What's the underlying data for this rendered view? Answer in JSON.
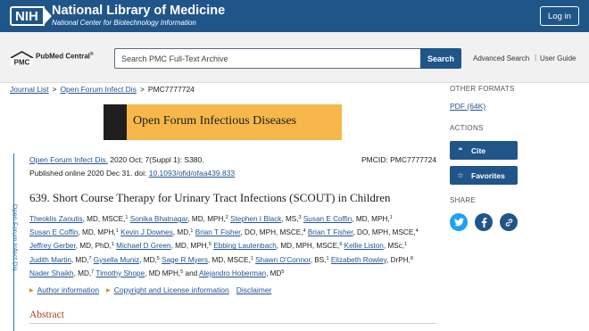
{
  "header": {
    "logo_text": "NIH",
    "title": "National Library of Medicine",
    "subtitle": "National Center for Biotechnology Information",
    "login_label": "Log in"
  },
  "pmc": {
    "logo_label": "PMC",
    "logo_text": "PubMed Central",
    "logo_reg": "®",
    "search_placeholder": "Search PMC Full-Text Archive",
    "search_button": "Search",
    "advanced_search": "Advanced Search",
    "divider": "|",
    "user_guide": "User Guide"
  },
  "breadcrumb": {
    "items": [
      "Journal List",
      "Open Forum Infect Dis",
      "PMC7777724"
    ],
    "separator": ">"
  },
  "journal_banner": "Open Forum Infectious Diseases",
  "side_vertical_label": "Open Forum Infect Dis",
  "citation": {
    "journal": "Open Forum Infect Dis.",
    "details": " 2020 Oct; 7(Suppl 1): S380.",
    "pmcid": "PMCID: PMC7777724",
    "published_prefix": "Published online 2020 Dec 31. doi: ",
    "doi": "10.1093/ofid/ofaa439.833"
  },
  "article_title": "639. Short Course Therapy for Urinary Tract Infections (SCOUT) in Children",
  "authors": [
    {
      "name": "Theoklis Zaoutis",
      "rest": ", MD, MSCE,",
      "sup": "1"
    },
    {
      "name": "Sonika Bhatnagar",
      "rest": ", MD, MPH,",
      "sup": "2"
    },
    {
      "name": "Stephen I Black",
      "rest": ", MS,",
      "sup": "3"
    },
    {
      "name": "Susan E Coffin",
      "rest": ", MD, MPH,",
      "sup": "1"
    },
    {
      "name": "Susan E Coffin",
      "rest": ", MD, MPH,",
      "sup": "1"
    },
    {
      "name": "Kevin J Downes",
      "rest": ", MD,",
      "sup": "1"
    },
    {
      "name": "Brian T Fisher",
      "rest": ", DO, MPH, MSCE,",
      "sup": "4"
    },
    {
      "name": "Brian T Fisher",
      "rest": ", DO, MPH, MSCE,",
      "sup": "4"
    },
    {
      "name": "Jeffrey Gerber",
      "rest": ", MD, PhD,",
      "sup": "1"
    },
    {
      "name": "Michael D Green",
      "rest": ", MD, MPH,",
      "sup": "5"
    },
    {
      "name": "Ebbing Lautenbach",
      "rest": ", MD, MPH, MSCE,",
      "sup": "6"
    },
    {
      "name": "Kellie Liston",
      "rest": ", MSc,",
      "sup": "1"
    },
    {
      "name": "Judith Martin",
      "rest": ", MD,",
      "sup": "7"
    },
    {
      "name": "Gysella Muniz",
      "rest": ", MD,",
      "sup": "5"
    },
    {
      "name": "Sage R Myers",
      "rest": ", MD, MSCE,",
      "sup": "1"
    },
    {
      "name": "Shawn O'Connor",
      "rest": ", BS,",
      "sup": "1"
    },
    {
      "name": "Elizabeth Rowley",
      "rest": ", DrPH,",
      "sup": "8"
    },
    {
      "name": "Nader Shaikh",
      "rest": ", MD,",
      "sup": "7"
    },
    {
      "name": "Timothy Shope",
      "rest": ", MD MPH,",
      "sup": "5"
    },
    {
      "name": "Alejandro Hoberman",
      "rest": ", MD",
      "sup": "5"
    }
  ],
  "authors_and": " and ",
  "info_links": {
    "author_info": "Author information",
    "copyright": "Copyright and License information",
    "disclaimer": "Disclaimer"
  },
  "abstract_heading": "Abstract",
  "sidebar": {
    "other_formats_heading": "OTHER FORMATS",
    "pdf_link": "PDF (64K)",
    "actions_heading": "ACTIONS",
    "cite_label": "Cite",
    "favorites_label": "Favorites",
    "share_heading": "SHARE"
  },
  "colors": {
    "nlm_blue": "#20558a",
    "link_blue": "#205493",
    "abstract_red": "#a5431d",
    "banner_orange": "#f6b84a",
    "twitter": "#1da1f2",
    "facebook": "#20558a"
  }
}
